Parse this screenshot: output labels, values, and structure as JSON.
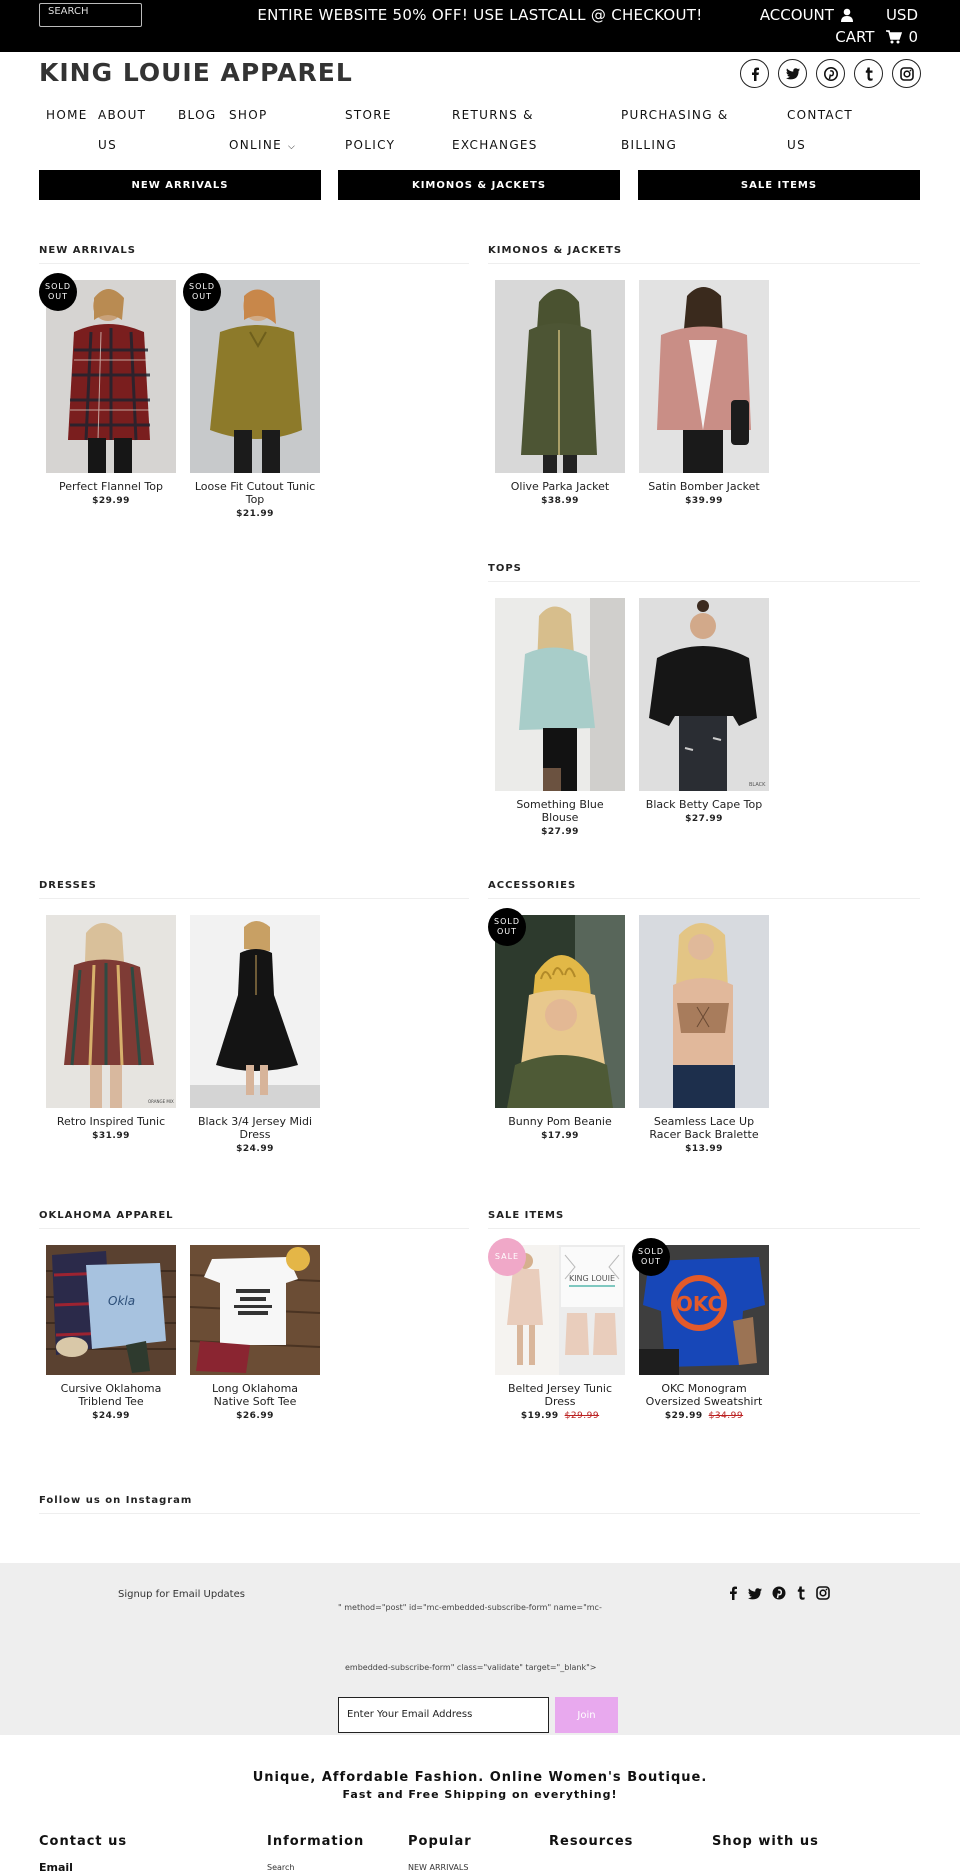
{
  "topbar": {
    "search_placeholder": "SEARCH",
    "promo": "ENTIRE WEBSITE 50% OFF! USE LASTCALL @ CHECKOUT!",
    "account_label": "ACCOUNT",
    "currency": "USD",
    "cart_label": "CART",
    "cart_count": "0"
  },
  "header": {
    "logo": "KING LOUIE APPAREL",
    "socials": [
      "facebook-icon",
      "twitter-icon",
      "pinterest-icon",
      "tumblr-icon",
      "instagram-icon"
    ]
  },
  "nav": {
    "home": [
      "HOME"
    ],
    "about": [
      "ABOUT",
      "US"
    ],
    "blog": [
      "BLOG"
    ],
    "shop": [
      "SHOP",
      "ONLINE"
    ],
    "store": [
      "STORE",
      "POLICY"
    ],
    "returns": [
      "RETURNS &",
      "EXCHANGES"
    ],
    "purchasing": [
      "PURCHASING &",
      "BILLING"
    ],
    "contact": [
      "CONTACT",
      "US"
    ]
  },
  "featured": {
    "new_arrivals": "NEW ARRIVALS",
    "kimonos": "KIMONOS & JACKETS",
    "sale": "SALE ITEMS"
  },
  "sections": {
    "new_arrivals": {
      "title": "NEW ARRIVALS",
      "products": [
        {
          "name": "Perfect Flannel Top",
          "price": "$29.99",
          "badge": "SOLD OUT"
        },
        {
          "name": "Loose Fit Cutout Tunic Top",
          "price": "$21.99",
          "badge": "SOLD OUT"
        }
      ]
    },
    "kimonos": {
      "title": "KIMONOS & JACKETS",
      "products": [
        {
          "name": "Olive Parka Jacket",
          "price": "$38.99"
        },
        {
          "name": "Satin Bomber Jacket",
          "price": "$39.99"
        }
      ]
    },
    "tops": {
      "title": "TOPS",
      "products": [
        {
          "name": "Something Blue Blouse",
          "price": "$27.99"
        },
        {
          "name": "Black Betty Cape Top",
          "price": "$27.99"
        }
      ]
    },
    "dresses": {
      "title": "DRESSES",
      "products": [
        {
          "name": "Retro Inspired Tunic",
          "price": "$31.99"
        },
        {
          "name": "Black 3/4 Jersey Midi Dress",
          "price": "$24.99"
        }
      ]
    },
    "accessories": {
      "title": "ACCESSORIES",
      "products": [
        {
          "name": "Bunny Pom Beanie",
          "price": "$17.99",
          "badge": "SOLD OUT"
        },
        {
          "name": "Seamless Lace Up Racer Back Bralette",
          "price": "$13.99"
        }
      ]
    },
    "oklahoma": {
      "title": "OKLAHOMA APPAREL",
      "products": [
        {
          "name": "Cursive Oklahoma Triblend Tee",
          "price": "$24.99"
        },
        {
          "name": "Long Oklahoma Native Soft Tee",
          "price": "$26.99"
        }
      ]
    },
    "sale": {
      "title": "SALE ITEMS",
      "products": [
        {
          "name": "Belted Jersey Tunic Dress",
          "price": "$19.99",
          "old_price": "$29.99",
          "badge": "SALE",
          "image_text": "KING LOUIE"
        },
        {
          "name": "OKC Monogram Oversized Sweatshirt",
          "price": "$29.99",
          "old_price": "$34.99",
          "badge": "SOLD OUT"
        }
      ]
    }
  },
  "instagram": {
    "title": "Follow us on Instagram"
  },
  "newsletter": {
    "label": "Signup for Email Updates",
    "code_line1": "\" method=\"post\" id=\"mc-embedded-subscribe-form\" name=\"mc-",
    "code_line2": "embedded-subscribe-form\" class=\"validate\" target=\"_blank\">",
    "placeholder": "Enter Your Email Address",
    "join": "Join"
  },
  "footer": {
    "tagline": "Unique, Affordable Fashion. Online Women's Boutique.",
    "tagline2": "Fast and Free Shipping on everything!",
    "contact": {
      "title": "Contact us",
      "item": "Email"
    },
    "information": {
      "title": "Information",
      "item": "Search"
    },
    "popular": {
      "title": "Popular",
      "item": "NEW ARRIVALS"
    },
    "resources": {
      "title": "Resources"
    },
    "shop_with_us": {
      "title": "Shop with us"
    }
  },
  "colors": {
    "topbar": "#000000",
    "sale_badge": "#f0a8c8",
    "join_button": "#e8a9ee",
    "old_price": "#bb2222",
    "newsletter_bg": "#eeeeee"
  }
}
